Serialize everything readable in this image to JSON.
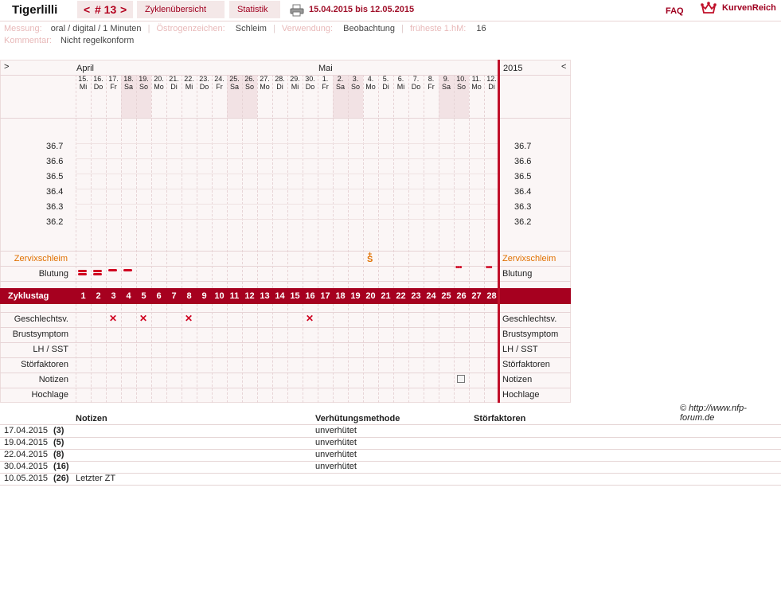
{
  "header": {
    "username": "Tigerlilli",
    "cycle_prev": "<",
    "cycle_label": "# 13",
    "cycle_next": ">",
    "tab_overview": "Zyklenübersicht",
    "tab_stats": "Statistik",
    "date_range": "15.04.2015 bis 12.05.2015",
    "faq": "FAQ",
    "brand": "KurvenReich"
  },
  "meta": {
    "messung_label": "Messung:",
    "messung_value": "oral / digital / 1 Minuten",
    "oestrogen_label": "Östrogenzeichen:",
    "oestrogen_value": "Schleim",
    "verwendung_label": "Verwendung:",
    "verwendung_value": "Beobachtung",
    "hm_label": "früheste 1.hM:",
    "hm_value": "16",
    "kommentar_label": "Kommentar:",
    "kommentar_value": "Nicht regelkonform"
  },
  "chart": {
    "nav_left": ">",
    "nav_right": "<",
    "month_april": "April",
    "month_mai": "Mai",
    "year": "2015",
    "days": [
      {
        "d": "15.",
        "w": "Mi",
        "we": false
      },
      {
        "d": "16.",
        "w": "Do",
        "we": false
      },
      {
        "d": "17.",
        "w": "Fr",
        "we": false
      },
      {
        "d": "18.",
        "w": "Sa",
        "we": true
      },
      {
        "d": "19.",
        "w": "So",
        "we": true
      },
      {
        "d": "20.",
        "w": "Mo",
        "we": false
      },
      {
        "d": "21.",
        "w": "Di",
        "we": false
      },
      {
        "d": "22.",
        "w": "Mi",
        "we": false
      },
      {
        "d": "23.",
        "w": "Do",
        "we": false
      },
      {
        "d": "24.",
        "w": "Fr",
        "we": false
      },
      {
        "d": "25.",
        "w": "Sa",
        "we": true
      },
      {
        "d": "26.",
        "w": "So",
        "we": true
      },
      {
        "d": "27.",
        "w": "Mo",
        "we": false
      },
      {
        "d": "28.",
        "w": "Di",
        "we": false
      },
      {
        "d": "29.",
        "w": "Mi",
        "we": false
      },
      {
        "d": "30.",
        "w": "Do",
        "we": false
      },
      {
        "d": "1.",
        "w": "Fr",
        "we": false
      },
      {
        "d": "2.",
        "w": "Sa",
        "we": true
      },
      {
        "d": "3.",
        "w": "So",
        "we": true
      },
      {
        "d": "4.",
        "w": "Mo",
        "we": false
      },
      {
        "d": "5.",
        "w": "Di",
        "we": false
      },
      {
        "d": "6.",
        "w": "Mi",
        "we": false
      },
      {
        "d": "7.",
        "w": "Do",
        "we": false
      },
      {
        "d": "8.",
        "w": "Fr",
        "we": false
      },
      {
        "d": "9.",
        "w": "Sa",
        "we": true
      },
      {
        "d": "10.",
        "w": "So",
        "we": true
      },
      {
        "d": "11.",
        "w": "Mo",
        "we": false
      },
      {
        "d": "12.",
        "w": "Di",
        "we": false
      }
    ],
    "temp_labels": [
      "36.7",
      "36.6",
      "36.5",
      "36.4",
      "36.3",
      "36.2"
    ],
    "zervix_label": "Zervixschleim",
    "blutung_label": "Blutung",
    "zyklustag_label": "Zyklustag",
    "zyklustage": [
      "1",
      "2",
      "3",
      "4",
      "5",
      "6",
      "7",
      "8",
      "9",
      "10",
      "11",
      "12",
      "13",
      "14",
      "15",
      "16",
      "17",
      "18",
      "19",
      "20",
      "21",
      "22",
      "23",
      "24",
      "25",
      "26",
      "27",
      "28"
    ],
    "rows": [
      "Geschlechtsv.",
      "Brustsymptom",
      "LH / SST",
      "Störfaktoren",
      "Notizen",
      "Hochlage"
    ],
    "zervix_mark_text": "S",
    "zervix_mark_plus": "+",
    "zervix_mark_day": 20,
    "blutung": [
      {
        "day": 1,
        "type": "stark"
      },
      {
        "day": 2,
        "type": "stark"
      },
      {
        "day": 3,
        "type": "mittel"
      },
      {
        "day": 4,
        "type": "mittel"
      },
      {
        "day": 26,
        "type": "schmier"
      },
      {
        "day": 28,
        "type": "schmier"
      }
    ],
    "gv_days": [
      3,
      5,
      8,
      16
    ],
    "gv_symbol": "✕",
    "notiz_day": 26,
    "colors": {
      "accent": "#a6001f",
      "weekend": "#f2e2e4",
      "zervix": "#e07000",
      "grid": "#e7d4d6"
    }
  },
  "copyright": "© http://www.nfp-forum.de",
  "table": {
    "col_notizen": "Notizen",
    "col_methode": "Verhütungsmethode",
    "col_stoer": "Störfaktoren",
    "rows": [
      {
        "date": "17.04.2015",
        "day": "(3)",
        "note": "",
        "methode": "unverhütet"
      },
      {
        "date": "19.04.2015",
        "day": "(5)",
        "note": "",
        "methode": "unverhütet"
      },
      {
        "date": "22.04.2015",
        "day": "(8)",
        "note": "",
        "methode": "unverhütet"
      },
      {
        "date": "30.04.2015",
        "day": "(16)",
        "note": "",
        "methode": "unverhütet"
      },
      {
        "date": "10.05.2015",
        "day": "(26)",
        "note": "Letzter ZT",
        "methode": ""
      }
    ]
  }
}
